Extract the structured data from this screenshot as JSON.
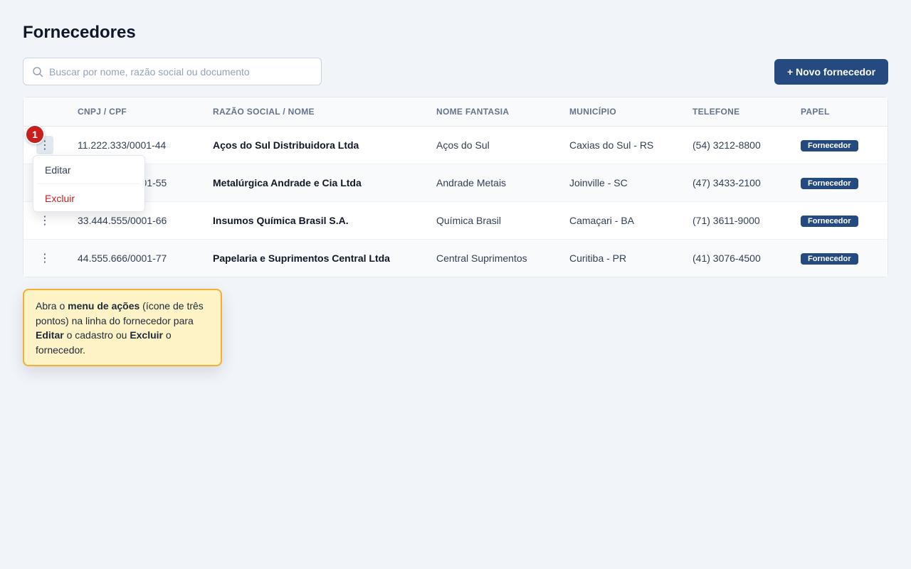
{
  "page": {
    "title": "Fornecedores"
  },
  "search": {
    "placeholder": "Buscar por nome, razão social ou documento",
    "value": ""
  },
  "toolbar": {
    "new_label": "+ Novo fornecedor"
  },
  "table": {
    "columns": [
      "CNPJ / CPF",
      "RAZÃO SOCIAL / NOME",
      "NOME FANTASIA",
      "MUNICÍPIO",
      "TELEFONE",
      "PAPEL"
    ],
    "rows": [
      {
        "doc": "11.222.333/0001-44",
        "name": "Aços do Sul Distribuidora Ltda",
        "fantasy": "Aços do Sul",
        "city": "Caxias do Sul - RS",
        "phone": "(54) 3212-8800",
        "role": "Fornecedor"
      },
      {
        "doc": "22.333.444/0001-55",
        "name": "Metalúrgica Andrade e Cia Ltda",
        "fantasy": "Andrade Metais",
        "city": "Joinville - SC",
        "phone": "(47) 3433-2100",
        "role": "Fornecedor"
      },
      {
        "doc": "33.444.555/0001-66",
        "name": "Insumos Química Brasil S.A.",
        "fantasy": "Química Brasil",
        "city": "Camaçari - BA",
        "phone": "(71) 3611-9000",
        "role": "Fornecedor"
      },
      {
        "doc": "44.555.666/0001-77",
        "name": "Papelaria e Suprimentos Central Ltda",
        "fantasy": "Central Suprimentos",
        "city": "Curitiba - PR",
        "phone": "(41) 3076-4500",
        "role": "Fornecedor"
      }
    ]
  },
  "row_menu": {
    "edit": "Editar",
    "delete": "Excluir"
  },
  "step_badge": "1",
  "kebab_glyph": "⋮",
  "tooltip": {
    "t1": "Abra o ",
    "b1": "menu de ações",
    "t2": " (ícone de três pontos) na linha do fornecedor para ",
    "b2": "Editar",
    "t3": " o cadastro ou ",
    "b3": "Excluir",
    "t4": " o fornecedor."
  },
  "colors": {
    "primary": "#244a7f",
    "danger": "#c81e1e",
    "tip_bg": "#fef3c7",
    "tip_border": "#f2b134"
  }
}
